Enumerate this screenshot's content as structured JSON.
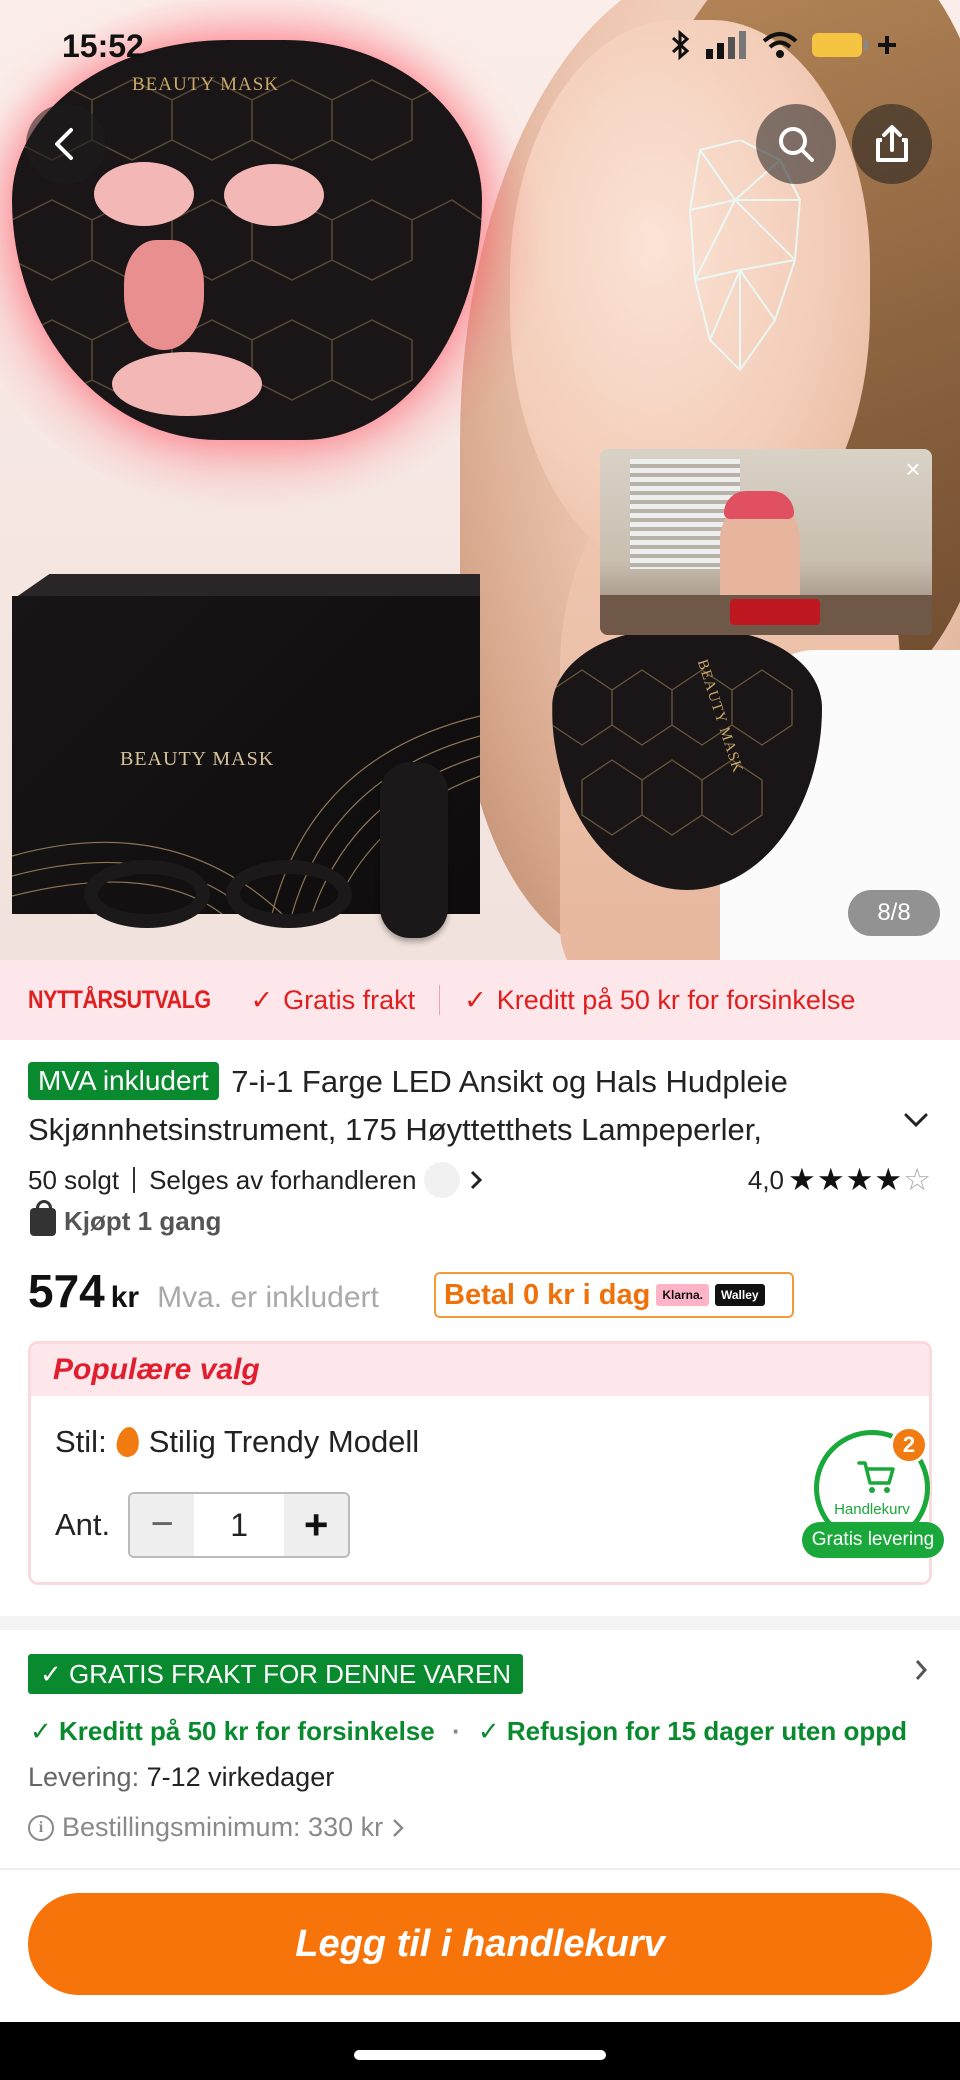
{
  "status_bar": {
    "time": "15:52"
  },
  "hero": {
    "mask_text": "BEAUTY MASK",
    "box_text": "BEAUTY MASK",
    "neck_mask_text": "BEAUTY MASK",
    "image_counter": "8/8",
    "video_close": "×"
  },
  "promo": {
    "brand": "NYTTÅRSUTVALG",
    "items": [
      "Gratis frakt",
      "Kreditt på 50 kr for forsinkelse"
    ]
  },
  "product": {
    "badge": "MVA inkludert",
    "title_line1": "7-i-1 Farge LED Ansikt og Hals Hudpleie",
    "title_line2": "Skjønnhetsinstrument, 175 Høyttetthets Lampeperler,",
    "sold": "50 solgt",
    "seller": "Selges av forhandleren",
    "rating_value": "4,0",
    "rating_stars": 4,
    "rating_max": 5,
    "bought": "Kjøpt 1 gang",
    "price": "574",
    "currency": "kr",
    "vat_note": "Mva. er inkludert",
    "pay_later": "Betal 0 kr i dag",
    "pay_logos": [
      "Klarna.",
      "Walley"
    ]
  },
  "options": {
    "header": "Populære valg",
    "style_label": "Stil:",
    "style_value": "Stilig Trendy Modell",
    "qty_label": "Ant.",
    "qty_value": "1"
  },
  "cart": {
    "badge": "2",
    "label": "Handlekurv",
    "delivery_pill": "Gratis levering"
  },
  "shipping": {
    "tag": "GRATIS FRAKT FOR DENNE VAREN",
    "benefit_1": "Kreditt på 50 kr for forsinkelse",
    "benefit_2": "Refusjon for 15 dager uten oppd",
    "delivery_label": "Levering:",
    "delivery_value": "7-12 virkedager",
    "min_order": "Bestillingsminimum: 330 kr"
  },
  "cta": {
    "label": "Legg til i handlekurv"
  },
  "colors": {
    "accent": "#f6740a",
    "green": "#0a8a2e",
    "red": "#e02020"
  }
}
